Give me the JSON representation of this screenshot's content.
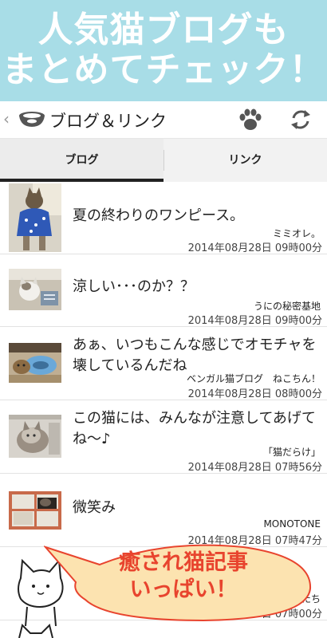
{
  "banner": {
    "line1": "人気猫ブログも",
    "line2": "まとめてチェック！"
  },
  "appbar": {
    "back": "‹",
    "title": "ブログ＆リンク"
  },
  "tabs": [
    {
      "label": "ブログ",
      "selected": true
    },
    {
      "label": "リンク",
      "selected": false
    }
  ],
  "items": [
    {
      "title": "夏の終わりのワンピース。",
      "source": "ミミオレ。",
      "date": "2014年08月28日 09時00分"
    },
    {
      "title": "涼しい･･･のか？？",
      "source": "うにの秘密基地",
      "date": "2014年08月28日 09時00分"
    },
    {
      "title": "あぁ、いつもこんな感じでオモチャを壊しているんだね",
      "source": "ベンガル猫ブログ　ねこちん！",
      "date": "2014年08月28日 08時00分"
    },
    {
      "title": "この猫には、みんなが注意してあげてね〜♪",
      "source": "「猫だらけ」",
      "date": "2014年08月28日 07時56分"
    },
    {
      "title": "微笑み",
      "source": "MONOTONE",
      "date": "2014年08月28日 07時47分"
    },
    {
      "title": "",
      "source": "ねこたち",
      "date": "2014年08月28日 07時00分"
    }
  ],
  "bubble": {
    "line1": "癒され猫記事",
    "line2": "いっぱい！"
  },
  "colors": {
    "banner_bg": "#a8dde7",
    "bubble_fill": "#fce3b0",
    "bubble_text": "#e8442e"
  }
}
